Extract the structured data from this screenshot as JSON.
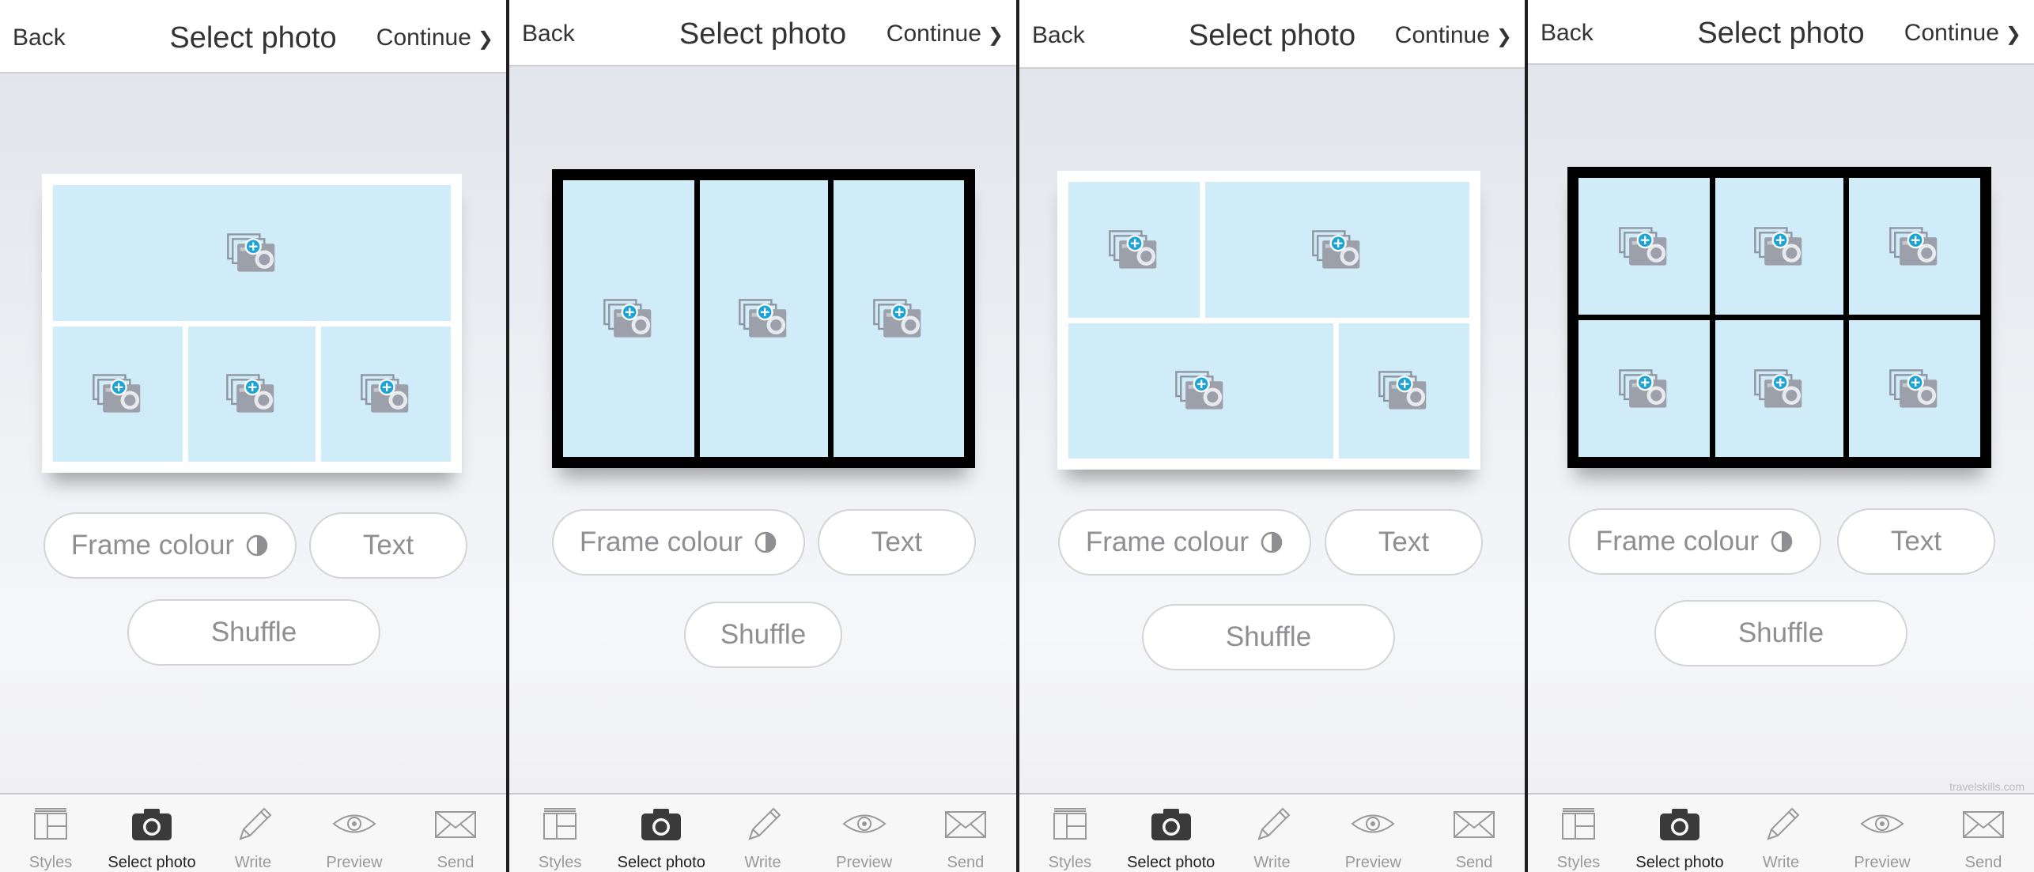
{
  "header": {
    "back": "Back",
    "title": "Select photo",
    "continue": "Continue",
    "continue_chevron": "❯"
  },
  "controls": {
    "frame_colour": "Frame colour",
    "text": "Text",
    "shuffle": "Shuffle"
  },
  "tabbar": {
    "active": "Select photo",
    "items": [
      {
        "label": "Styles",
        "icon": "styles-icon"
      },
      {
        "label": "Select photo",
        "icon": "camera-icon"
      },
      {
        "label": "Write",
        "icon": "pencil-icon"
      },
      {
        "label": "Preview",
        "icon": "eye-icon"
      },
      {
        "label": "Send",
        "icon": "envelope-icon"
      }
    ]
  },
  "colors": {
    "photo_slot": "#d0ecf8",
    "frame_white": "#ffffff",
    "frame_black": "#000000",
    "add_badge": "#1ba4d8",
    "inactive_text": "#8e8e93"
  },
  "screens": [
    {
      "frame_colour": "white",
      "layout": "one wide photo on top, three photos below",
      "photo_slots": 4
    },
    {
      "frame_colour": "black",
      "layout": "three vertical photos",
      "photo_slots": 3
    },
    {
      "frame_colour": "white",
      "layout": "two rows of two photos with alternating widths",
      "photo_slots": 4
    },
    {
      "frame_colour": "black",
      "layout": "two rows of three photos",
      "photo_slots": 6
    }
  ],
  "watermark": "travelskills.com"
}
